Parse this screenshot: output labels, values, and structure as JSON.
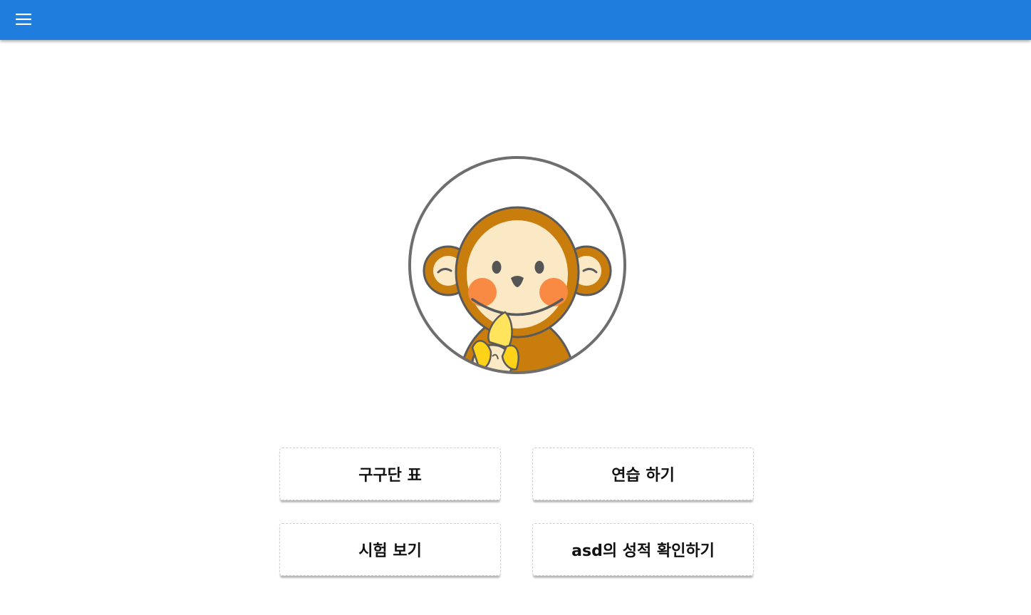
{
  "header": {
    "menu_icon": "hamburger-menu-icon",
    "color": "#1e7ddd"
  },
  "avatar": {
    "image": "monkey-eating-banana"
  },
  "menu": {
    "buttons": [
      {
        "label": "구구단 표"
      },
      {
        "label": "연습 하기"
      },
      {
        "label": "시험 보기"
      },
      {
        "label": "asd의 성적 확인하기"
      }
    ]
  }
}
